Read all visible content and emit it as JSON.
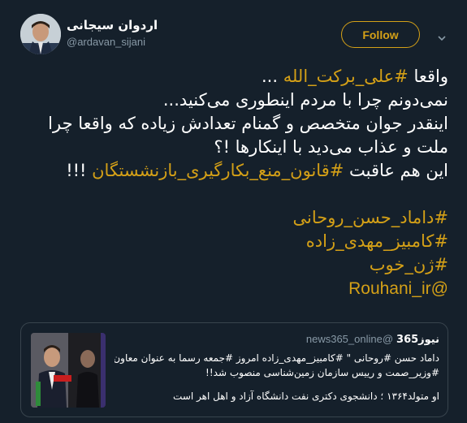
{
  "author": {
    "name": "اردوان سیجانی",
    "handle": "@ardavan_sijani",
    "follow_label": "Follow"
  },
  "tweet": {
    "l1_text": "واقعا ",
    "l1_tag": "#علی_برکت_الله",
    "l1_end": " ...",
    "l2": "نمی‌دونم چرا با مردم اینطوری می‌کنید...",
    "l3": "اینقدر جوان متخصص و گمنام تعدادش زیاده که واقعا چرا",
    "l4": "ملت و عذاب می‌دید با اینکارها !؟",
    "l5_text": "این هم عاقبت ",
    "l5_tag": "#قانون_منع_بکارگیری_بازنشستگان",
    "l5_end": " !!!",
    "hashtags": [
      "#داماد_حسن_روحانی",
      "#کامبیز_مهدی_زاده",
      "#ژن_خوب"
    ],
    "mention": "@Rouhani_ir"
  },
  "quote": {
    "name": "نیوز365",
    "handle": "@news365_online",
    "line1": "داماد حسن #روحانی \" #کامبیز_مهدی_زاده امروز #جمعه رسما به عنوان معاون",
    "line2": "#وزیر_صمت و رییس سازمان زمین‌شناسی منصوب شد!!",
    "line3": "او متولد۱۳۶۴ ؛ دانشجوی دکتری نفت دانشگاه آزاد و اهل اهر است"
  },
  "colors": {
    "background": "#15202b",
    "accent": "#d4a017",
    "secondary_text": "#8899a6",
    "border": "#38444d"
  },
  "icons": [
    "avatar",
    "chevron-down-icon",
    "news-photo"
  ]
}
